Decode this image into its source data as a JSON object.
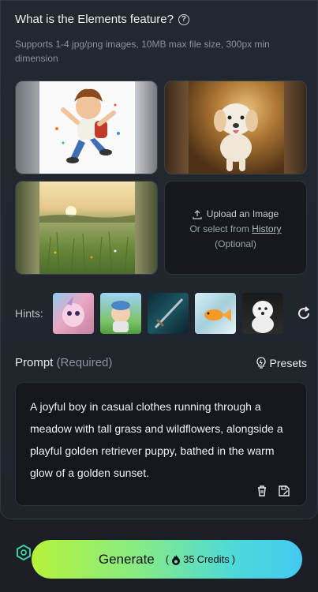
{
  "header": {
    "title": "What is the Elements feature?",
    "subtitle": "Supports 1-4 jpg/png images, 10MB max file size, 300px min dimension"
  },
  "upload": {
    "line1": "Upload an Image",
    "line2_prefix": "Or select from",
    "history_link": "History",
    "line3": "(Optional)"
  },
  "hints": {
    "label": "Hints:"
  },
  "prompt": {
    "label": "Prompt",
    "required": "(Required)",
    "presets_label": "Presets",
    "text": "A joyful boy in casual clothes running through a meadow with tall grass and wildflowers, alongside a playful golden retriever puppy, bathed in the warm glow of a golden sunset."
  },
  "generate": {
    "label": "Generate",
    "credits_open": "(",
    "credits_value": "35",
    "credits_label": "Credits",
    "credits_close": ")"
  },
  "colors": {
    "background": "#1b1e24",
    "panel": "#232830",
    "gradient_start": "#b6f23a",
    "gradient_end": "#44c9f2"
  }
}
